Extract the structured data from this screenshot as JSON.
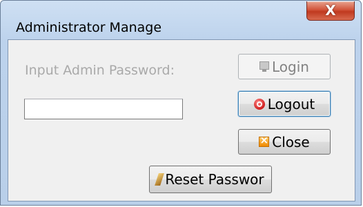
{
  "window": {
    "title": "Administrator Manage",
    "close_glyph": "X"
  },
  "form": {
    "password_label": "Input Admin Password:",
    "password_value": "",
    "password_placeholder": ""
  },
  "buttons": {
    "login": "Login",
    "logout": "Logout",
    "close": "Close",
    "reset": "Reset Passwor"
  },
  "icons": {
    "login": "monitor-icon",
    "logout": "logout-icon",
    "close": "close-box-icon",
    "reset": "pen-icon"
  },
  "colors": {
    "titlebar": "#bcd2ec",
    "close_button": "#c03a1f",
    "client_bg": "#f0f0f0",
    "disabled_text": "#a9a9a9"
  }
}
